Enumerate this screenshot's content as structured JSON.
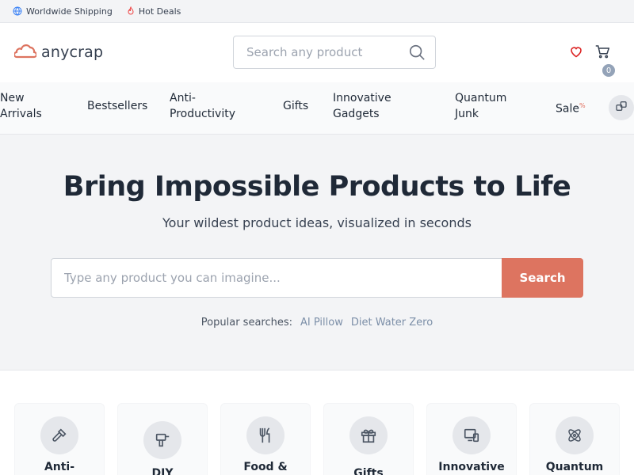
{
  "topbar": {
    "shipping_label": "Worldwide Shipping",
    "deals_label": "Hot Deals"
  },
  "header": {
    "logo_text": "anycrap",
    "search_placeholder": "Search any product",
    "cart_count": "0"
  },
  "nav": {
    "items": [
      {
        "line1": "New",
        "line2": "Arrivals"
      },
      {
        "line1": "Bestsellers",
        "line2": ""
      },
      {
        "line1": "Anti-",
        "line2": "Productivity"
      },
      {
        "line1": "Gifts",
        "line2": ""
      },
      {
        "line1": "Innovative",
        "line2": "Gadgets"
      },
      {
        "line1": "Quantum",
        "line2": "Junk"
      },
      {
        "line1": "Sale",
        "line2": ""
      }
    ],
    "sale_badge": "%"
  },
  "hero": {
    "title": "Bring Impossible Products to Life",
    "subtitle": "Your wildest product ideas, visualized in seconds",
    "input_placeholder": "Type any product you can imagine...",
    "button_label": "Search",
    "popular_label": "Popular searches:",
    "popular_tags": [
      "AI Pillow",
      "Diet Water Zero"
    ]
  },
  "categories": [
    {
      "label": "Anti-",
      "icon": "hammer-icon"
    },
    {
      "label": "DIY",
      "icon": "drill-icon"
    },
    {
      "label": "Food &",
      "icon": "utensils-icon"
    },
    {
      "label": "Gifts",
      "icon": "gift-icon"
    },
    {
      "label": "Innovative",
      "icon": "devices-icon"
    },
    {
      "label": "Quantum",
      "icon": "atom-icon"
    }
  ],
  "colors": {
    "accent": "#dd7460",
    "heart": "#dc2626",
    "badge": "#94a3b8"
  }
}
